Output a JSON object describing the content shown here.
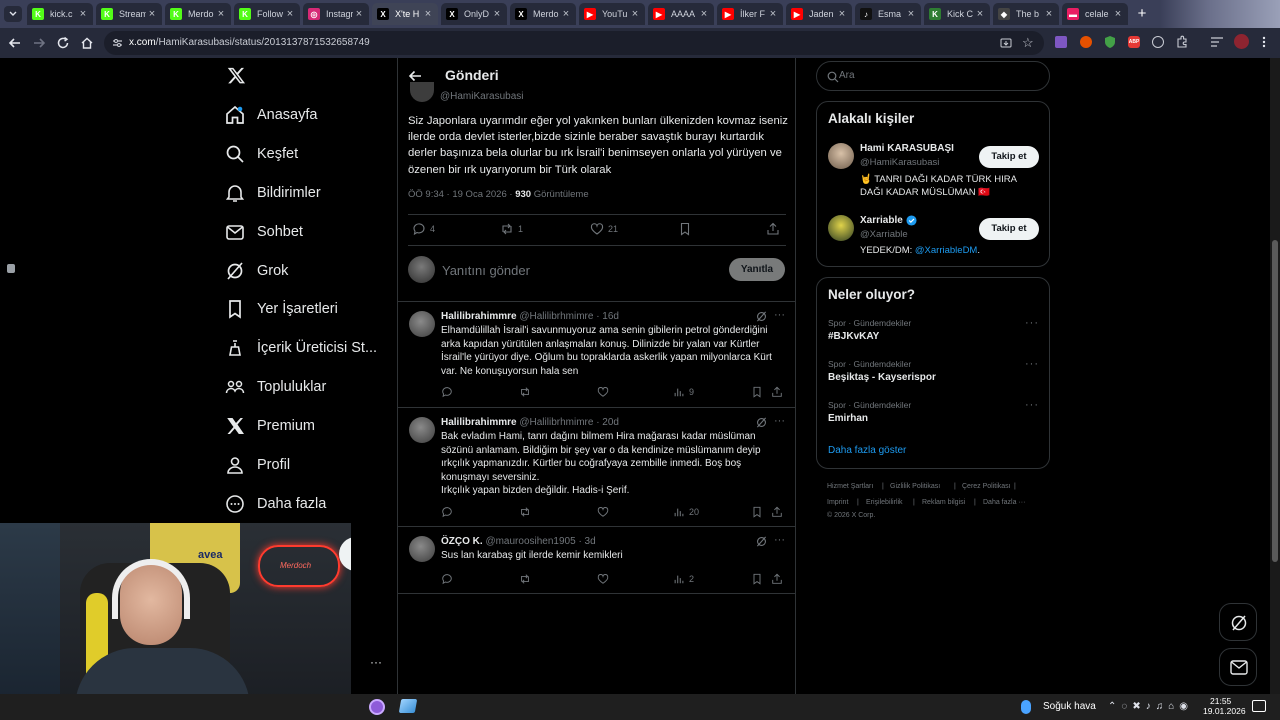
{
  "browser": {
    "tabs": [
      {
        "label": "kick.c",
        "color": "#53fc18",
        "glyph": "K"
      },
      {
        "label": "Stream",
        "color": "#53fc18",
        "glyph": "K"
      },
      {
        "label": "Merdo",
        "color": "#53fc18",
        "glyph": "K"
      },
      {
        "label": "Follow",
        "color": "#53fc18",
        "glyph": "K"
      },
      {
        "label": "Instagr",
        "color": "#d62976",
        "glyph": "◎"
      },
      {
        "label": "X'te H",
        "color": "#000000",
        "glyph": "X"
      },
      {
        "label": "OnlyD",
        "color": "#000000",
        "glyph": "X"
      },
      {
        "label": "Merdo",
        "color": "#000000",
        "glyph": "X"
      },
      {
        "label": "YouTu",
        "color": "#ff0000",
        "glyph": "▶"
      },
      {
        "label": "AAAA",
        "color": "#ff0000",
        "glyph": "▶"
      },
      {
        "label": "İlker F",
        "color": "#ff0000",
        "glyph": "▶"
      },
      {
        "label": "Jaden",
        "color": "#ff0000",
        "glyph": "▶"
      },
      {
        "label": "Esma",
        "color": "#111111",
        "glyph": "♪"
      },
      {
        "label": "Kick C",
        "color": "#2e7d32",
        "glyph": "K"
      },
      {
        "label": "The b",
        "color": "#444444",
        "glyph": "◆"
      },
      {
        "label": "celale",
        "color": "#e91e63",
        "glyph": "▬"
      }
    ],
    "url_host": "x.com",
    "url_path": "/HamiKarasubasi/status/2013137871532658749"
  },
  "nav": {
    "logo": "X",
    "items": [
      {
        "label": "Anasayfa",
        "icon": "home-icon"
      },
      {
        "label": "Keşfet",
        "icon": "search-icon"
      },
      {
        "label": "Bildirimler",
        "icon": "bell-icon"
      },
      {
        "label": "Sohbet",
        "icon": "mail-icon"
      },
      {
        "label": "Grok",
        "icon": "grok-icon"
      },
      {
        "label": "Yer İşaretleri",
        "icon": "bookmark-icon"
      },
      {
        "label": "İçerik Üreticisi St...",
        "icon": "creator-icon"
      },
      {
        "label": "Topluluklar",
        "icon": "communities-icon"
      },
      {
        "label": "Premium",
        "icon": "x-premium-icon"
      },
      {
        "label": "Profil",
        "icon": "profile-icon"
      },
      {
        "label": "Daha fazla",
        "icon": "more-circle-icon"
      }
    ],
    "account_more": "···"
  },
  "header": {
    "title": "Gönderi"
  },
  "post": {
    "handle": "@HamiKarasubasi",
    "text": "Siz Japonlara uyarımdır eğer yol yakınken bunları ülkenizden kovmaz iseniz ilerde orda devlet isterler,bizde sizinle beraber savaştık burayı kurtardık derler başınıza bela olurlar bu ırk İsrail'i benimseyen onlarla yol yürüyen ve özenen bir ırk uyarıyorum bir Türk olarak",
    "time": "ÖÖ 9:34 · 19 Oca 2026 ·",
    "views": "930",
    "views_label": "Görüntüleme",
    "replies": "4",
    "reposts": "1",
    "likes": "21"
  },
  "composer": {
    "placeholder": "Yanıtını gönder",
    "button": "Yanıtla"
  },
  "replies": [
    {
      "name": "Halilibrahimmre",
      "handle": "@Halilibrhmimre · 16d",
      "text": "Elhamdülillah İsrail'i savunmuyoruz ama senin gibilerin petrol gönderdiğini arka kapıdan yürütülen anlaşmaları konuş. Dilinizde bir yalan var Kürtler İsrail'le yürüyor diye. Oğlum bu topraklarda askerlik yapan milyonlarca Kürt var. Ne konuşuyorsun hala sen",
      "views": "9"
    },
    {
      "name": "Halilibrahimmre",
      "handle": "@Halilibrhmimre · 20d",
      "text": "Bak evladım Hami, tanrı dağını bilmem Hira mağarası kadar müslüman sözünü anlamam. Bildiğim bir şey var o da kendinize müslümanım deyip ırkçılık yapmanızdır. Kürtler bu coğrafyaya zembille inmedi. Boş boş konuşmayı seversiniz.\nIrkçılık yapan bizden değildir. Hadis-i Şerif.",
      "views": "20"
    },
    {
      "name": "ÖZÇO K.",
      "handle": "@mauroosihen1905 · 3d",
      "text": "Sus lan karabaş git ilerde kemir kemikleri",
      "views": "2"
    }
  ],
  "search": {
    "placeholder": "Ara"
  },
  "related": {
    "title": "Alakalı kişiler",
    "people": [
      {
        "name": "Hami KARASUBAŞI",
        "handle": "@HamiKarasubasi",
        "bio": "🤘 TANRI DAĞI KADAR TÜRK HIRA DAĞI KADAR MÜSLÜMAN 🇹🇷",
        "button": "Takip et",
        "verified": false
      },
      {
        "name": "Xarriable",
        "handle": "@Xarriable",
        "bio_prefix": "YEDEK/DM: ",
        "bio_link": "@XarriableDM",
        "bio_suffix": ".",
        "button": "Takip et",
        "verified": true
      }
    ]
  },
  "trends": {
    "title": "Neler oluyor?",
    "items": [
      {
        "category": "Spor · Gündemdekiler",
        "name": "#BJKvKAY"
      },
      {
        "category": "Spor · Gündemdekiler",
        "name": "Beşiktaş - Kayserispor"
      },
      {
        "category": "Spor · Gündemdekiler",
        "name": "Emirhan"
      }
    ],
    "more": "Daha fazla göster"
  },
  "footer": {
    "links": [
      "Hizmet Şartları",
      "|",
      "Gizlilik Politikası",
      "|",
      "Çerez Politikası",
      "|",
      "Imprint",
      "|",
      "Erişilebilirlik",
      "|",
      "Reklam bilgisi",
      "|",
      "Daha fazla ···"
    ],
    "copyright": "© 2026 X Corp."
  },
  "taskbar": {
    "weather": "Soğuk hava",
    "time": "21:55",
    "date": "19.01.2026"
  },
  "webcam": {
    "sign": "Merdoch",
    "jersey": "avea"
  },
  "colors": {
    "accent": "#1d9bf0",
    "border": "#2f3336",
    "muted": "#71767b"
  }
}
